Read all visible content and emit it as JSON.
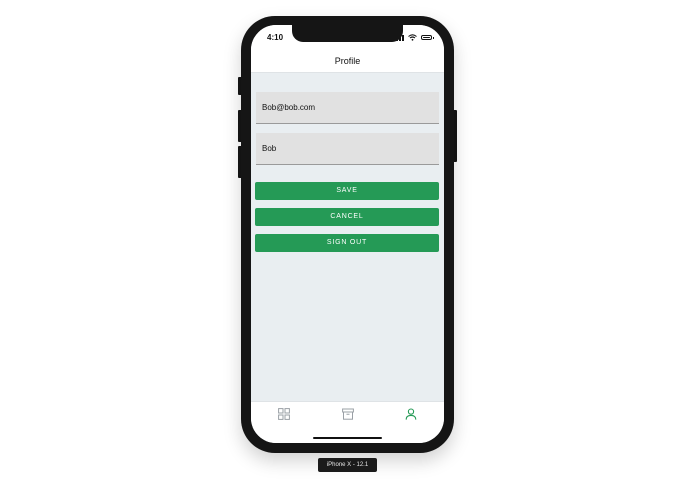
{
  "status_bar": {
    "time": "4:10"
  },
  "header": {
    "title": "Profile"
  },
  "form": {
    "email_value": "Bob@bob.com",
    "name_value": "Bob"
  },
  "buttons": {
    "save_label": "SAVE",
    "cancel_label": "CANCEL",
    "signout_label": "SIGN OUT"
  },
  "tabbar": {
    "items": [
      {
        "icon": "grid-icon",
        "active": false
      },
      {
        "icon": "archive-icon",
        "active": false
      },
      {
        "icon": "user-icon",
        "active": true
      }
    ]
  },
  "device_label": "iPhone X - 12.1",
  "colors": {
    "accent": "#259a56",
    "screen_background": "#e9eef1",
    "input_background": "#e1e1e1",
    "inactive_icon": "#9aa0a6",
    "device_frame": "#151515"
  }
}
